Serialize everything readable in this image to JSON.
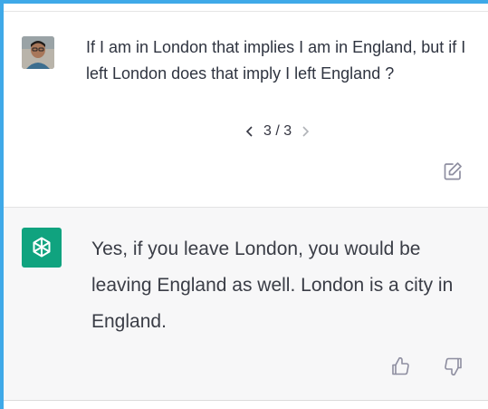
{
  "conversation": {
    "user_message": "If I am in London that implies I am in England, but if I left London does that imply I left England ?",
    "pager": {
      "current": "3",
      "separator": "/",
      "total": "3",
      "display": "3 / 3"
    },
    "assistant_message": "Yes, if you leave London, you would be leaving England as well. London is a city in England."
  },
  "icons": {
    "user_avatar": "user-photo-avatar",
    "assistant_avatar": "openai-logo",
    "edit": "edit-icon",
    "thumbs_up": "thumbs-up-icon",
    "thumbs_down": "thumbs-down-icon",
    "prev": "chevron-left-icon",
    "next": "chevron-right-icon"
  },
  "colors": {
    "brand": "#10a37f",
    "assistant_bg": "#f7f7f8",
    "frame": "#3fa9e8"
  }
}
